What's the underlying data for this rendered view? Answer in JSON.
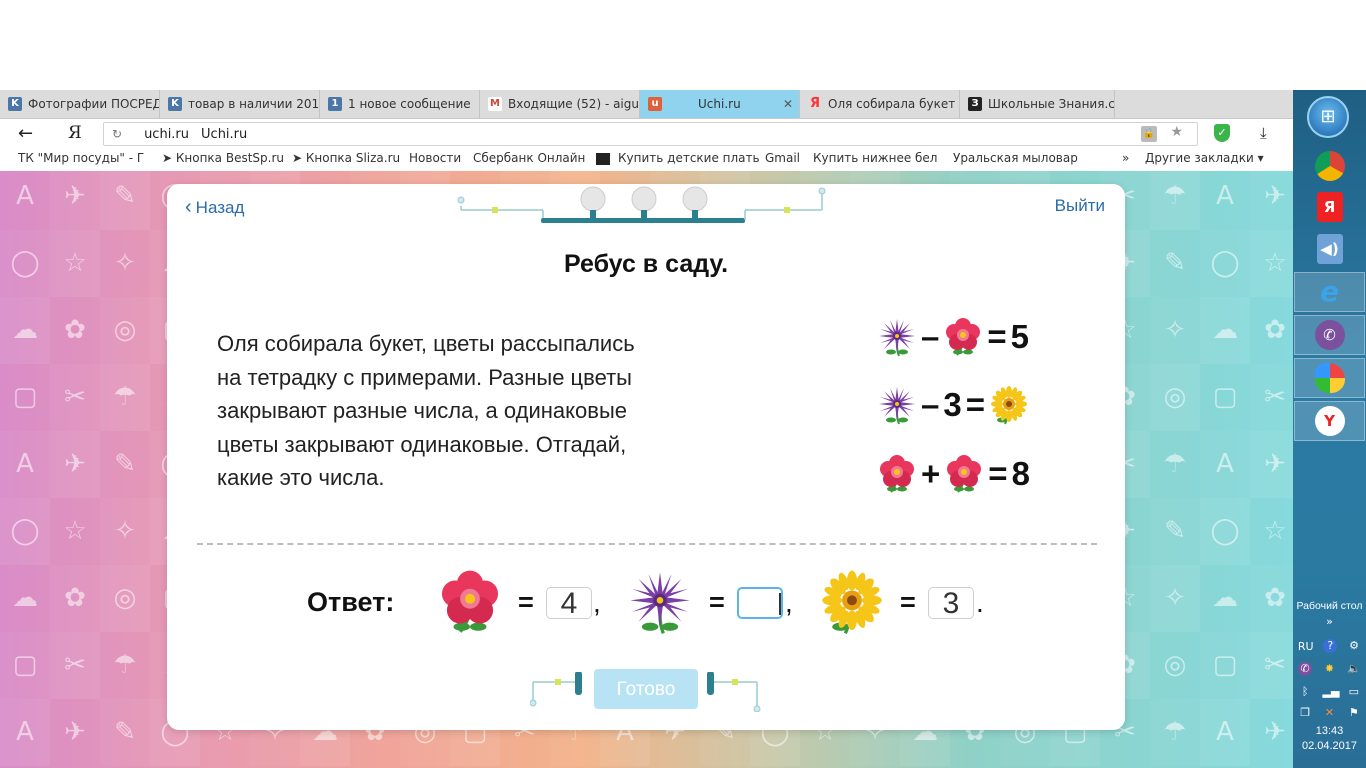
{
  "browser": {
    "tabs": [
      {
        "label": "Фотографии ПОСРЕД",
        "icon": "vk-icon",
        "color": "#4a76a8"
      },
      {
        "label": "товар в наличии 201",
        "icon": "vk-icon",
        "color": "#4a76a8"
      },
      {
        "label": "1 новое сообщение",
        "icon": "message-count-icon",
        "color": "#4a76a8"
      },
      {
        "label": "Входящие (52) - aigu",
        "icon": "gmail-icon",
        "color": "#d44638"
      },
      {
        "label": "Uchi.ru",
        "icon": "uchi-icon",
        "color": "#e0603b",
        "active": true
      },
      {
        "label": "Оля собирала букет",
        "icon": "yandex-icon",
        "color": "#f33"
      },
      {
        "label": "Школьные Знания.co",
        "icon": "znaniya-icon",
        "color": "#222"
      }
    ],
    "new_tab_symbol": "+",
    "address": {
      "domain": "uchi.ru",
      "title": "Uchi.ru"
    },
    "yandex_logo": "Я",
    "bookmarks": [
      "ТК \"Мир посуды\" - Г",
      "Кнопка BestSp.ru",
      "Кнопка Sliza.ru",
      "Новости",
      "Сбербанк Онлайн",
      "Купить детские плать",
      "Gmail",
      "Купить нижнее бель",
      "Уральская мыловаре",
      "Другие закладки"
    ],
    "bookmarks_more": "»"
  },
  "card": {
    "back_label": "Назад",
    "exit_label": "Выйти",
    "title": "Ребус в саду.",
    "text_lines": [
      "Оля собирала букет, цветы рассыпались",
      "на тетрадку с примерами. Разные цветы",
      "закрывают разные числа, а одинаковые",
      "цветы закрывают одинаковые. Отгадай,",
      "какие это числа."
    ],
    "equations": [
      {
        "left": "purple-flower",
        "op": "–",
        "right": "pink-flower",
        "eq": "=",
        "result": "5"
      },
      {
        "left": "purple-flower",
        "op": "–",
        "right_num": "3",
        "eq": "=",
        "result_flower": "yellow-flower"
      },
      {
        "left": "pink-flower",
        "op": "+",
        "right": "pink-flower",
        "eq": "=",
        "result": "8"
      }
    ],
    "answer": {
      "label": "Ответ:",
      "eq": "=",
      "items": [
        {
          "flower": "pink-flower",
          "value": "4",
          "punct": ","
        },
        {
          "flower": "purple-flower",
          "value": "",
          "punct": ","
        },
        {
          "flower": "yellow-flower",
          "value": "3",
          "punct": "."
        }
      ]
    },
    "done_label": "Готово",
    "colors": {
      "pink": "#e8365d",
      "purple": "#7b3fa6",
      "yellow": "#f5c518",
      "link": "#2a6ca8",
      "button": "#b8e3f4"
    }
  },
  "taskbar": {
    "desktop_label": "Рабочий стол",
    "desktop_chevron": "»",
    "lang": "RU",
    "time": "13:43",
    "date": "02.04.2017",
    "apps": [
      "chrome-icon",
      "yandex-browser-icon",
      "volume-app-icon",
      "ie-icon",
      "viber-icon",
      "paint-icon",
      "yandex-icon"
    ]
  }
}
